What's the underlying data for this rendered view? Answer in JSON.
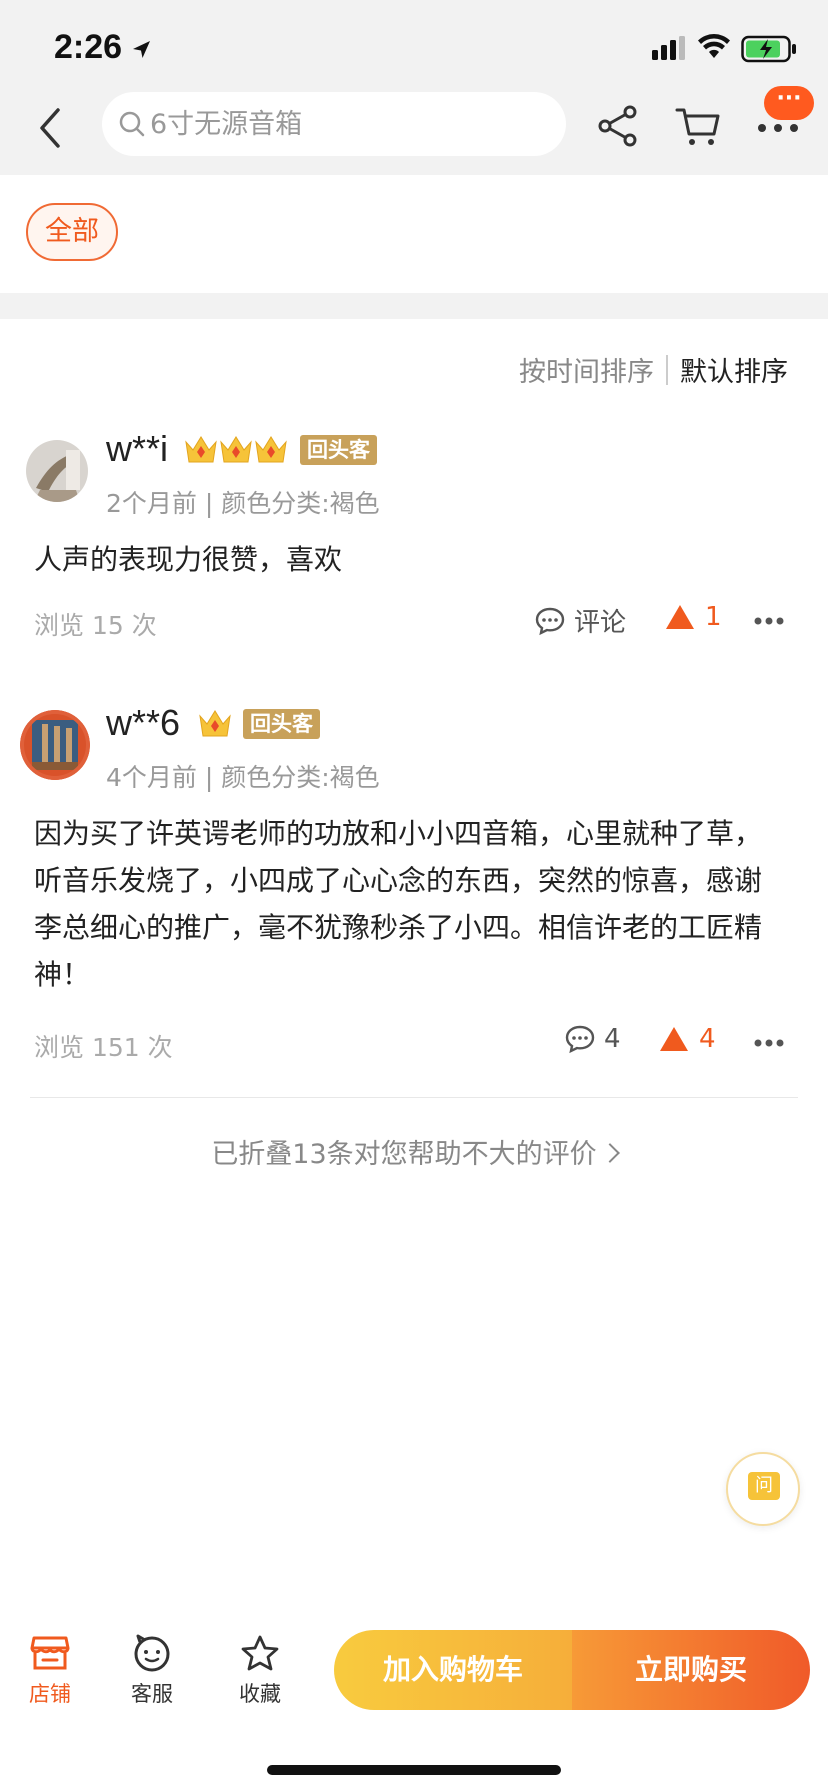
{
  "status_bar": {
    "time": "2:26"
  },
  "nav": {
    "search_placeholder": "6寸无源音箱",
    "more_badge": "···"
  },
  "filter": {
    "chip_all": "全部"
  },
  "sort": {
    "by_time": "按时间排序",
    "by_default": "默认排序"
  },
  "reviews": [
    {
      "user": "w**i",
      "crowns": 3,
      "badge": "回头客",
      "meta": "2个月前 | 颜色分类:褐色",
      "content": "人声的表现力很赞，喜欢",
      "views": "浏览 15 次",
      "comment_label": "评论",
      "likes": "1"
    },
    {
      "user": "w**6",
      "crowns": 1,
      "badge": "回头客",
      "meta": "4个月前 | 颜色分类:褐色",
      "content": "因为买了许英谔老师的功放和小小四音箱，心里就种了草，听音乐发烧了，小四成了心心念的东西，突然的惊喜，感谢李总细心的推广，毫不犹豫秒杀了小四。相信许老的工匠精神！",
      "views": "浏览 151 次",
      "comment_label": "4",
      "likes": "4"
    }
  ],
  "folded_text": "已折叠13条对您帮助不大的评价",
  "ask_label": "问",
  "bottom": {
    "store": "店铺",
    "service": "客服",
    "favorite": "收藏",
    "add_cart": "加入购物车",
    "buy_now": "立即购买"
  },
  "colors": {
    "accent": "#f05a1e",
    "badge_gold": "#c8a15a",
    "cart_yellow": "#f8cb3e"
  }
}
